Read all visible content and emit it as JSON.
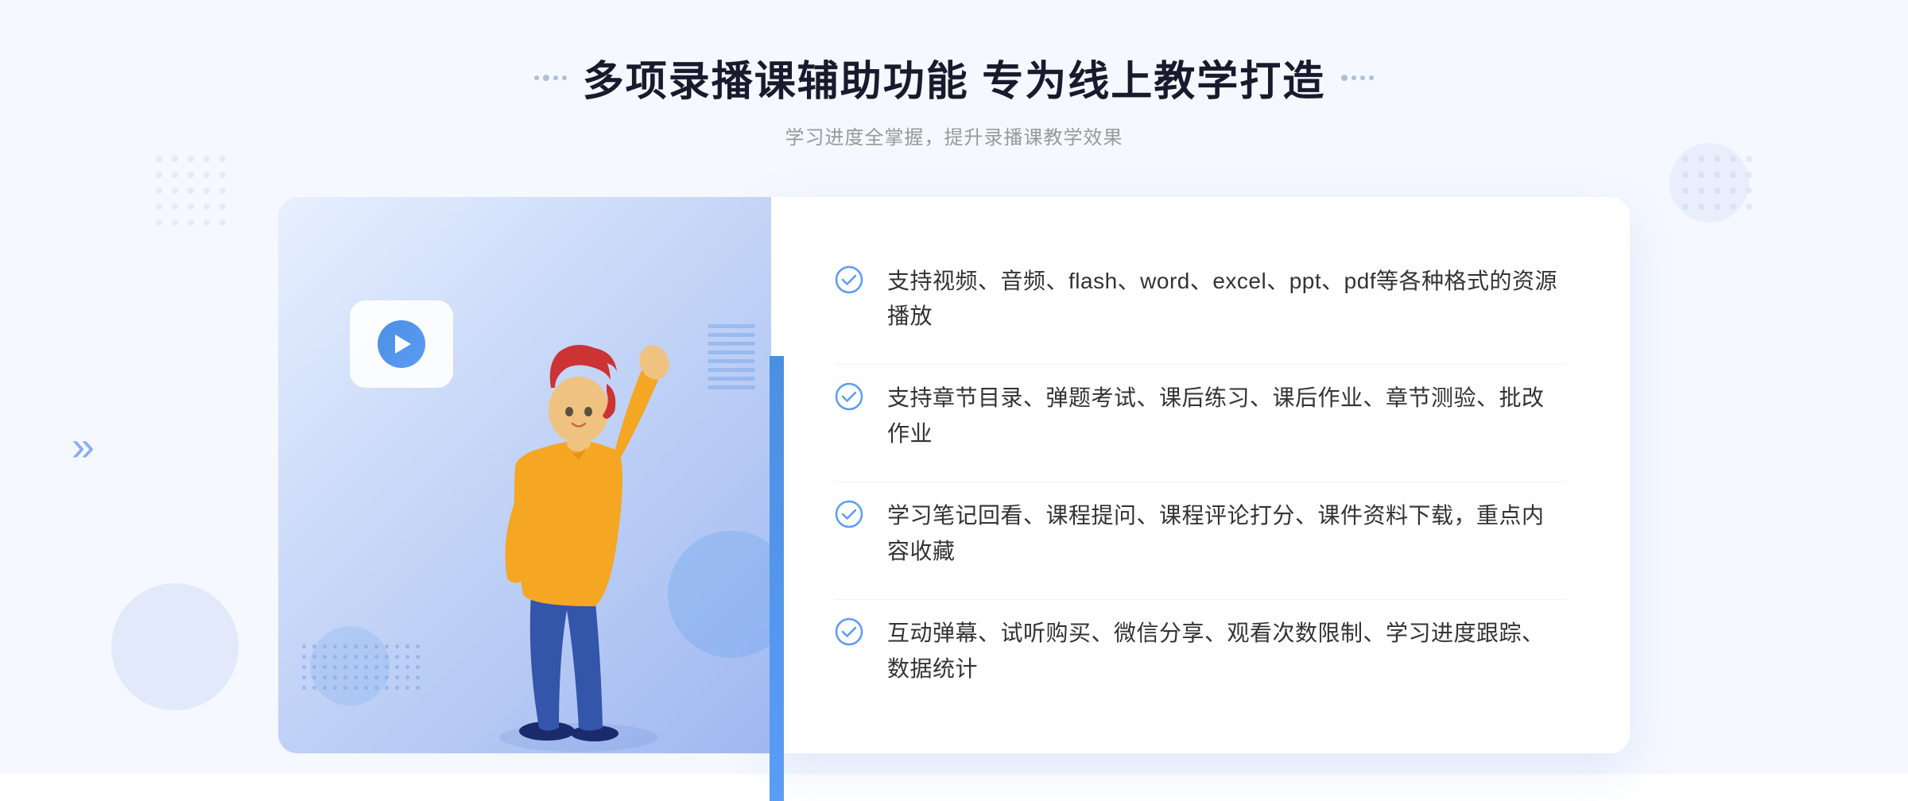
{
  "header": {
    "title": "多项录播课辅助功能 专为线上教学打造",
    "subtitle": "学习进度全掌握，提升录播课教学效果",
    "deco_dots_left": "··",
    "deco_dots_right": "··"
  },
  "features": [
    {
      "id": 1,
      "text": "支持视频、音频、flash、word、excel、ppt、pdf等各种格式的资源播放"
    },
    {
      "id": 2,
      "text": "支持章节目录、弹题考试、课后练习、课后作业、章节测验、批改作业"
    },
    {
      "id": 3,
      "text": "学习笔记回看、课程提问、课程评论打分、课件资料下载，重点内容收藏"
    },
    {
      "id": 4,
      "text": "互动弹幕、试听购买、微信分享、观看次数限制、学习进度跟踪、数据统计"
    }
  ],
  "colors": {
    "accent_blue": "#4a90e2",
    "light_blue": "#5b9cf6",
    "title_dark": "#1a1a2e",
    "text_gray": "#333333",
    "subtitle_gray": "#999999",
    "bg_light": "#f5f8ff",
    "check_color": "#5b9cf6"
  },
  "icons": {
    "check": "checkmark-circle",
    "play": "play-circle",
    "chevron": "double-chevron-right"
  }
}
